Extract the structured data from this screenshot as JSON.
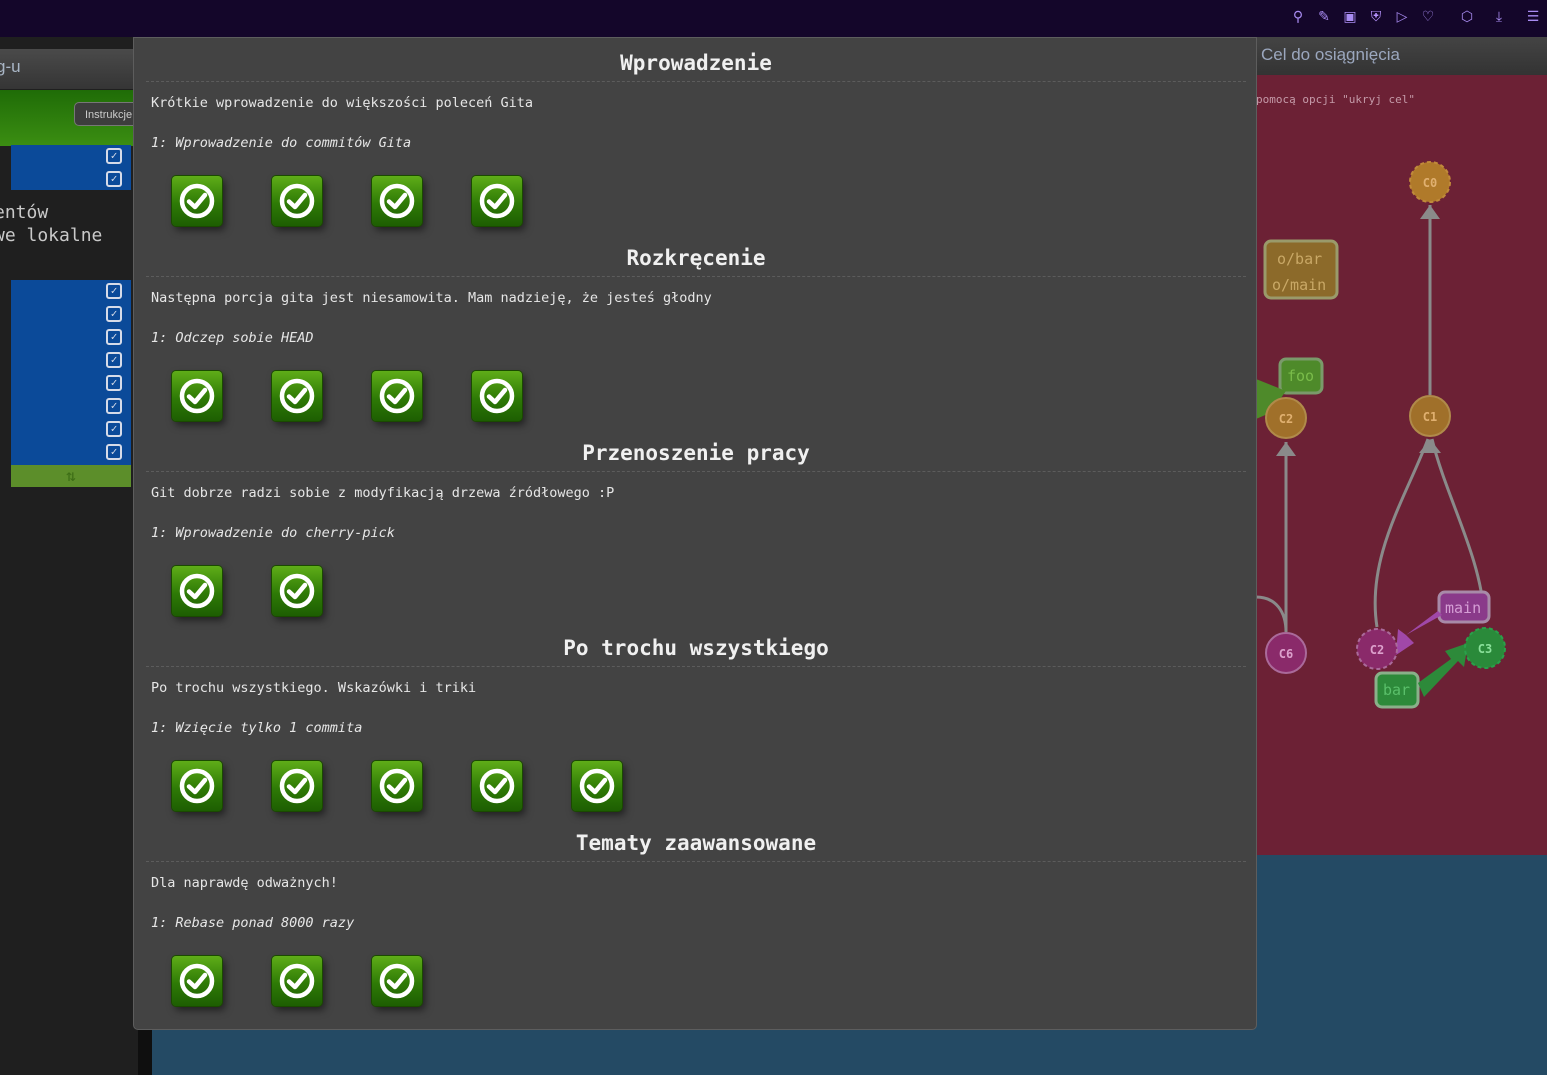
{
  "browser": {
    "toolbar_icons": [
      "zoom-icon",
      "edit-icon",
      "camera-icon",
      "shield-icon",
      "send-icon",
      "heart-icon",
      "cube-icon",
      "download-icon",
      "menu-icon"
    ]
  },
  "left_panel": {
    "title_fragment": "g-u",
    "instructions_button": "Instrukcje",
    "text_line_1": "entów",
    "text_line_2": "we lokalne"
  },
  "goal_panel": {
    "title": "Cel do osiągnięcia",
    "hint": "pomocą opcji \"ukryj cel\"",
    "nodes": [
      "C0",
      "C1",
      "C2",
      "C6",
      "C2",
      "C3"
    ],
    "branch_labels": [
      "o/bar",
      "o/main",
      "foo",
      "main",
      "bar"
    ]
  },
  "modal": {
    "sections": [
      {
        "title": "Wprowadzenie",
        "description": "Krótkie wprowadzenie do większości poleceń Gita",
        "level": "1: Wprowadzenie do commitów Gita",
        "level_count": 4,
        "completed": [
          true,
          true,
          true,
          true
        ]
      },
      {
        "title": "Rozkręcenie",
        "description": "Następna porcja gita jest niesamowita. Mam nadzieję, że jesteś głodny",
        "level": "1: Odczep sobie HEAD",
        "level_count": 4,
        "completed": [
          true,
          true,
          true,
          true
        ]
      },
      {
        "title": "Przenoszenie pracy",
        "description": "Git dobrze radzi sobie z modyfikacją drzewa źródłowego :P",
        "level": "1: Wprowadzenie do cherry-pick",
        "level_count": 2,
        "completed": [
          true,
          true
        ]
      },
      {
        "title": "Po trochu wszystkiego",
        "description": "Po trochu wszystkiego. Wskazówki i triki",
        "level": "1: Wzięcie tylko 1 commita",
        "level_count": 5,
        "completed": [
          true,
          true,
          true,
          true,
          true
        ]
      },
      {
        "title": "Tematy zaawansowane",
        "description": "Dla naprawdę odważnych!",
        "level": "1: Rebase ponad 8000 razy",
        "level_count": 3,
        "completed": [
          true,
          true,
          true
        ]
      }
    ]
  },
  "colors": {
    "modal_bg": "#434343",
    "level_complete": "#2e7a06",
    "goal_bg": "#6c2135",
    "page_bg": "#244a64"
  }
}
